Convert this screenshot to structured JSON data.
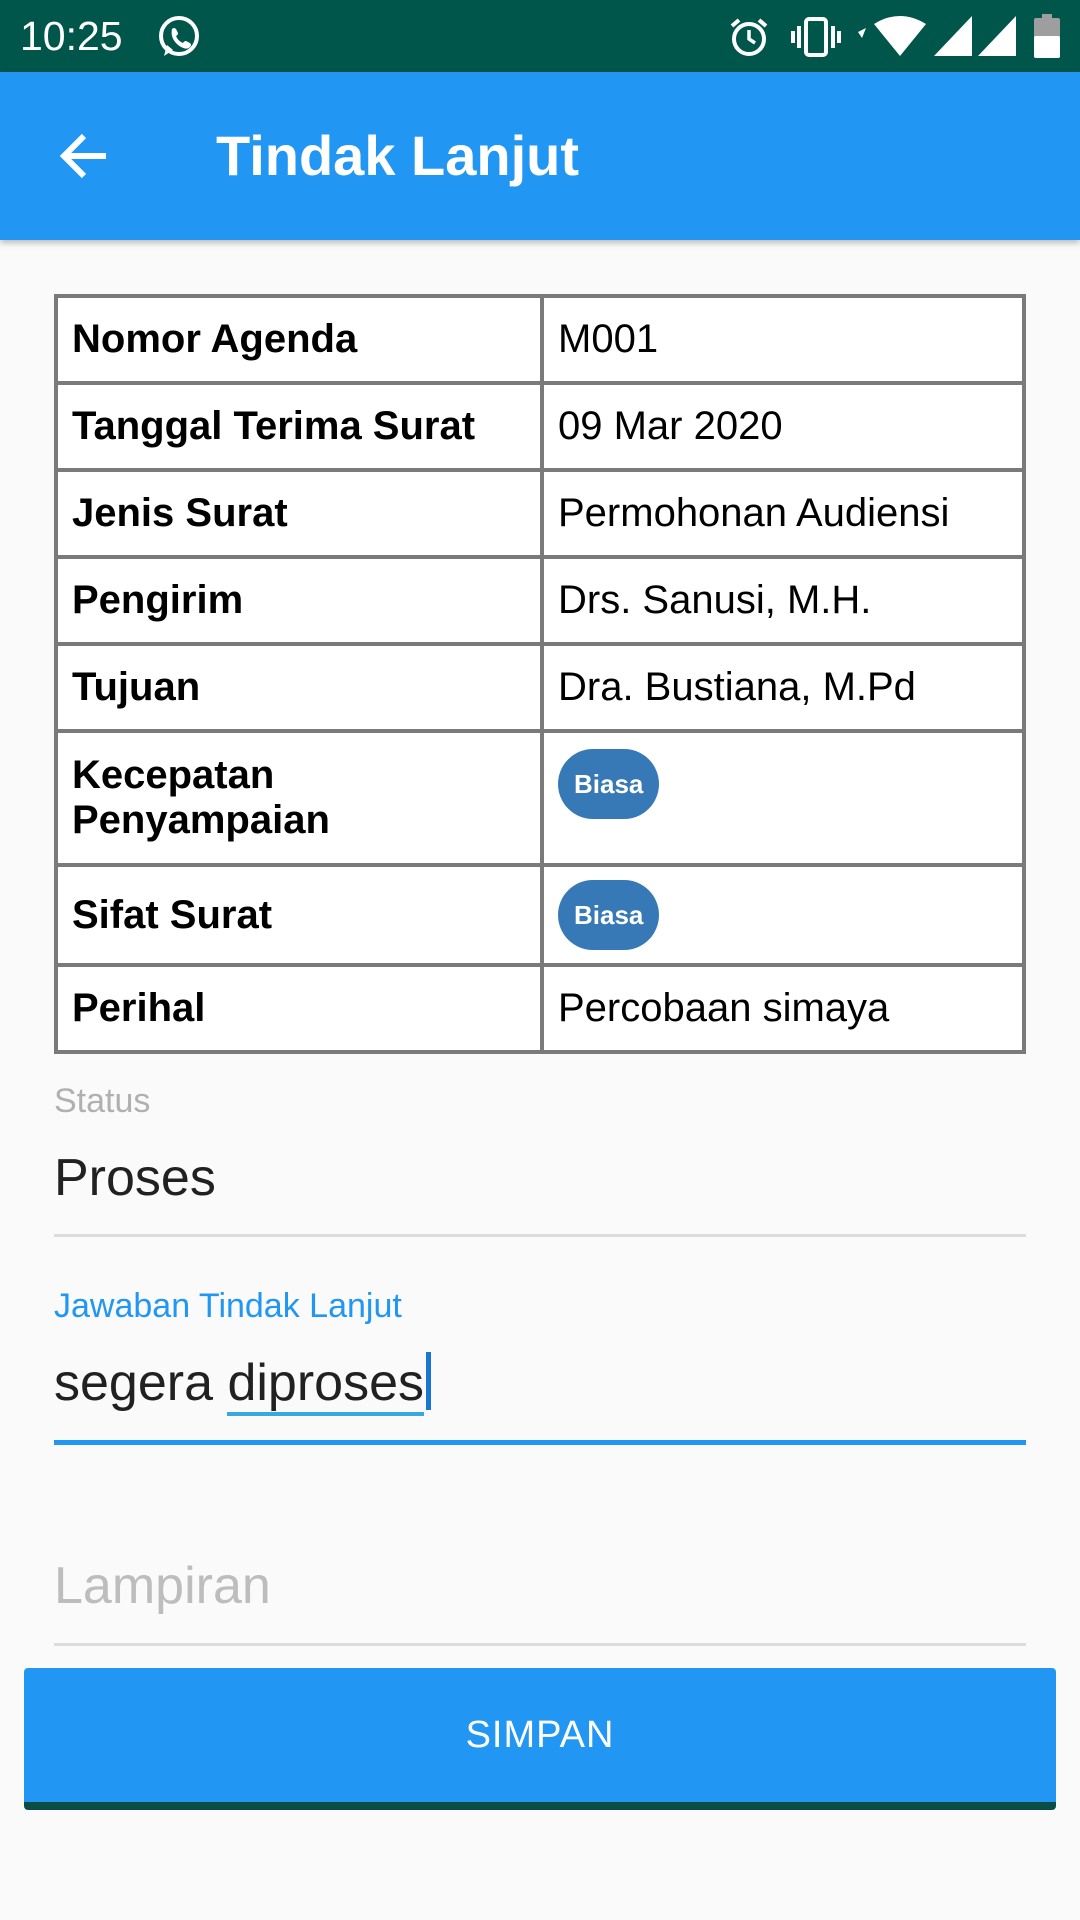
{
  "status_bar": {
    "time": "10:25",
    "icons": [
      "whatsapp-icon",
      "alarm-icon",
      "vibrate-icon",
      "wifi-icon",
      "signal-icon",
      "signal-icon",
      "battery-icon"
    ]
  },
  "app_bar": {
    "title": "Tindak Lanjut",
    "back_icon": "arrow-back-icon",
    "color": "#2196f3"
  },
  "table": {
    "rows": [
      {
        "label": "Nomor Agenda",
        "value": "M001"
      },
      {
        "label": "Tanggal Terima Surat",
        "value": "09 Mar 2020"
      },
      {
        "label": "Jenis Surat",
        "value": "Permohonan Audiensi"
      },
      {
        "label": "Pengirim",
        "value": "Drs. Sanusi, M.H."
      },
      {
        "label": "Tujuan",
        "value": "Dra. Bustiana, M.Pd"
      },
      {
        "label": "Kecepatan Penyampaian",
        "badge": "Biasa"
      },
      {
        "label": "Sifat Surat",
        "badge": "Biasa"
      },
      {
        "label": "Perihal",
        "value": "Percobaan simaya"
      }
    ],
    "badge_color": "#3778b6"
  },
  "form": {
    "status": {
      "label": "Status",
      "value": "Proses"
    },
    "jawaban": {
      "label": "Jawaban Tindak Lanjut",
      "value_part1": "segera ",
      "value_part2": "diproses"
    },
    "lampiran": {
      "placeholder": "Lampiran"
    }
  },
  "save_button": {
    "label": "SIMPAN"
  },
  "colors": {
    "status_bar": "#00564a",
    "accent": "#2196f3",
    "focused_label": "#2196f3",
    "hint": "#b0b0b0"
  }
}
